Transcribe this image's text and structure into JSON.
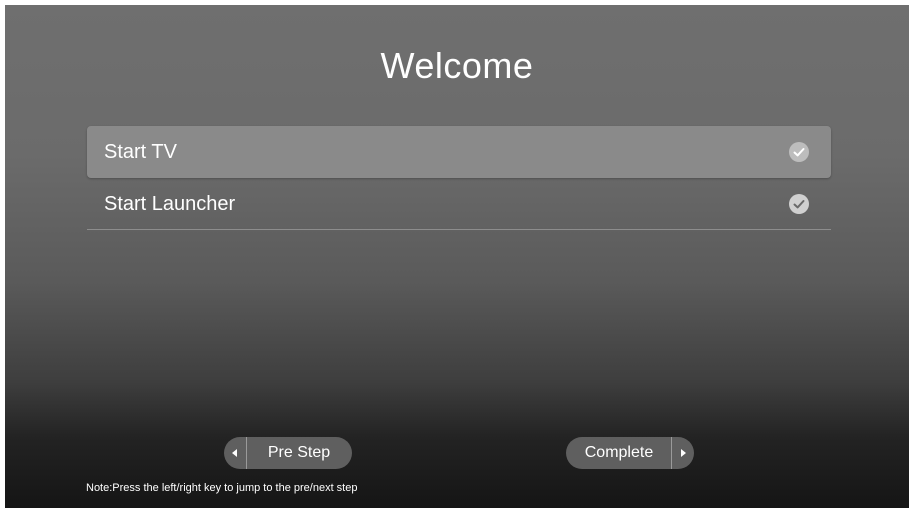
{
  "header": {
    "title": "Welcome"
  },
  "options": [
    {
      "label": "Start TV",
      "selected": true,
      "check_icon": "check-circle-icon"
    },
    {
      "label": "Start Launcher",
      "selected": false,
      "check_icon": "check-circle-icon"
    }
  ],
  "navigation": {
    "prev_label": "Pre Step",
    "prev_icon": "arrow-left-icon",
    "next_label": "Complete",
    "next_icon": "arrow-right-icon"
  },
  "footer": {
    "note": "Note:Press the left/right key to jump to the pre/next step"
  },
  "colors": {
    "background_top": "#6f6f6f",
    "background_bottom": "#151515",
    "selected_row": "#8a8a8a",
    "button": "#5f5f5f",
    "text": "#ffffff"
  }
}
